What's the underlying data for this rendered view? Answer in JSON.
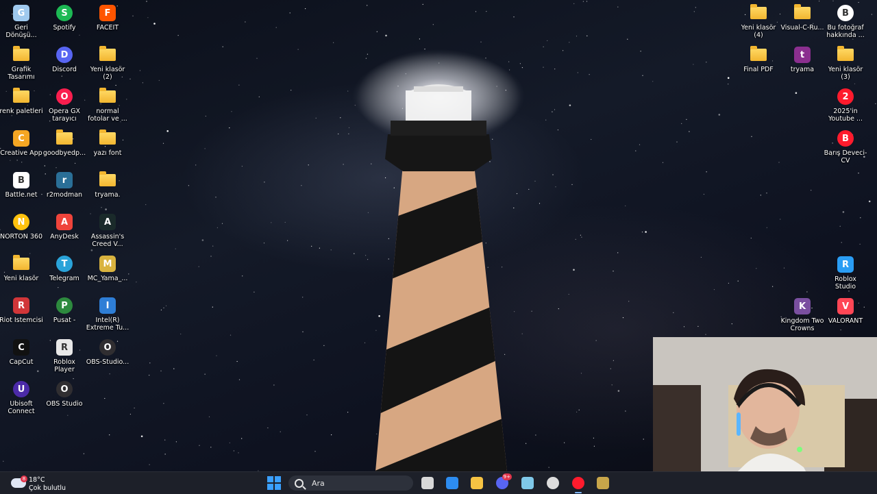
{
  "desktop": {
    "icons_left": [
      {
        "label": "Geri Dönüşü...",
        "icon": "recycle-bin-icon",
        "color": "#9fc9ee"
      },
      {
        "label": "Spotify",
        "icon": "spotify-icon",
        "color": "#1db954"
      },
      {
        "label": "FACEIT",
        "icon": "faceit-icon",
        "color": "#ff5500"
      },
      {
        "label": "Grafik Tasarımı",
        "icon": "folder-icon"
      },
      {
        "label": "Discord",
        "icon": "discord-icon",
        "color": "#5865f2"
      },
      {
        "label": "Yeni klasör (2)",
        "icon": "folder-icon"
      },
      {
        "label": "renk paletleri",
        "icon": "folder-icon"
      },
      {
        "label": "Opera GX tarayıcı",
        "icon": "opera-gx-icon",
        "color": "#fa1e4e"
      },
      {
        "label": "normal fotolar ve ...",
        "icon": "folder-icon"
      },
      {
        "label": "Creative App",
        "icon": "creative-app-icon",
        "color": "#f5a623"
      },
      {
        "label": "goodbyedp...",
        "icon": "folder-icon"
      },
      {
        "label": "yazı font",
        "icon": "folder-icon"
      },
      {
        "label": "Battle.net",
        "icon": "battlenet-icon",
        "color": "#ffffff"
      },
      {
        "label": "r2modman",
        "icon": "r2modman-icon",
        "color": "#2a6f97"
      },
      {
        "label": "tryama.",
        "icon": "folder-icon"
      },
      {
        "label": "NORTON 360",
        "icon": "norton-icon",
        "color": "#ffc20e"
      },
      {
        "label": "AnyDesk",
        "icon": "anydesk-icon",
        "color": "#ef443b"
      },
      {
        "label": "Assassin's Creed V...",
        "icon": "assassins-creed-icon",
        "color": "#1a2a2a"
      },
      {
        "label": "Yeni klasör",
        "icon": "folder-icon"
      },
      {
        "label": "Telegram",
        "icon": "telegram-icon",
        "color": "#2aa3d9"
      },
      {
        "label": "MC_Yama_...",
        "icon": "mc-yama-icon",
        "color": "#d9b33f"
      },
      {
        "label": "Riot İstemcisi",
        "icon": "riot-icon",
        "color": "#d13639"
      },
      {
        "label": "Pusat -",
        "icon": "pusat-icon",
        "color": "#2d8a3e"
      },
      {
        "label": "Intel(R) Extreme Tu...",
        "icon": "intel-xtu-icon",
        "color": "#2e7ed6"
      },
      {
        "label": "CapCut",
        "icon": "capcut-icon",
        "color": "#111111"
      },
      {
        "label": "Roblox Player",
        "icon": "roblox-player-icon",
        "color": "#e8e8e8"
      },
      {
        "label": "OBS-Studio...",
        "icon": "obs-studio-icon",
        "color": "#302e31"
      },
      {
        "label": "Ubisoft Connect",
        "icon": "ubisoft-icon",
        "color": "#4b2aa8"
      },
      {
        "label": "OBS Studio",
        "icon": "obs-studio-icon",
        "color": "#302e31"
      }
    ],
    "icons_right": [
      {
        "label": "Yeni klasör (4)",
        "icon": "folder-icon"
      },
      {
        "label": "Visual-C-Ru...",
        "icon": "folder-icon"
      },
      {
        "label": "Bu fotoğraf hakkında ...",
        "icon": "camera-info-icon",
        "color": "#ffffff"
      },
      {
        "label": "Final PDF",
        "icon": "folder-icon"
      },
      {
        "label": "tryama",
        "icon": "winrar-icon",
        "color": "#8b2f8f"
      },
      {
        "label": "Yeni klasör (3)",
        "icon": "folder-icon"
      },
      {
        "label": "2025'in Youtube ...",
        "icon": "opera-icon",
        "color": "#ff1b2d"
      },
      {
        "label": "Barış Deveci-CV",
        "icon": "opera-icon",
        "color": "#ff1b2d"
      },
      {
        "label": "Roblox Studio",
        "icon": "roblox-studio-icon",
        "color": "#2a9df4"
      },
      {
        "label": "Kingdom Two Crowns",
        "icon": "kingdom-two-crowns-icon",
        "color": "#7a4fa0"
      },
      {
        "label": "VALORANT",
        "icon": "valorant-icon",
        "color": "#ff4655"
      }
    ]
  },
  "taskbar": {
    "weather": {
      "temp": "18°C",
      "condition": "Çok bulutlu",
      "badge": "8"
    },
    "search": {
      "placeholder": "Ara"
    },
    "apps": [
      {
        "name": "start",
        "icon": "windows-start-icon",
        "color": "#3aa0ff"
      },
      {
        "name": "task-view",
        "icon": "task-view-icon",
        "color": "#d8d8d8"
      },
      {
        "name": "store",
        "icon": "microsoft-store-icon",
        "color": "#2d8cf0"
      },
      {
        "name": "file-explorer",
        "icon": "file-explorer-icon",
        "color": "#f6c343"
      },
      {
        "name": "discord",
        "icon": "discord-icon",
        "color": "#5865f2",
        "badge": "9+"
      },
      {
        "name": "app-6",
        "icon": "cube-app-icon",
        "color": "#7fc8e8"
      },
      {
        "name": "obs",
        "icon": "obs-studio-icon",
        "color": "#dddddd"
      },
      {
        "name": "opera",
        "icon": "opera-icon",
        "color": "#ff1b2d",
        "active": true
      },
      {
        "name": "league",
        "icon": "league-icon",
        "color": "#c8a64a"
      }
    ]
  }
}
